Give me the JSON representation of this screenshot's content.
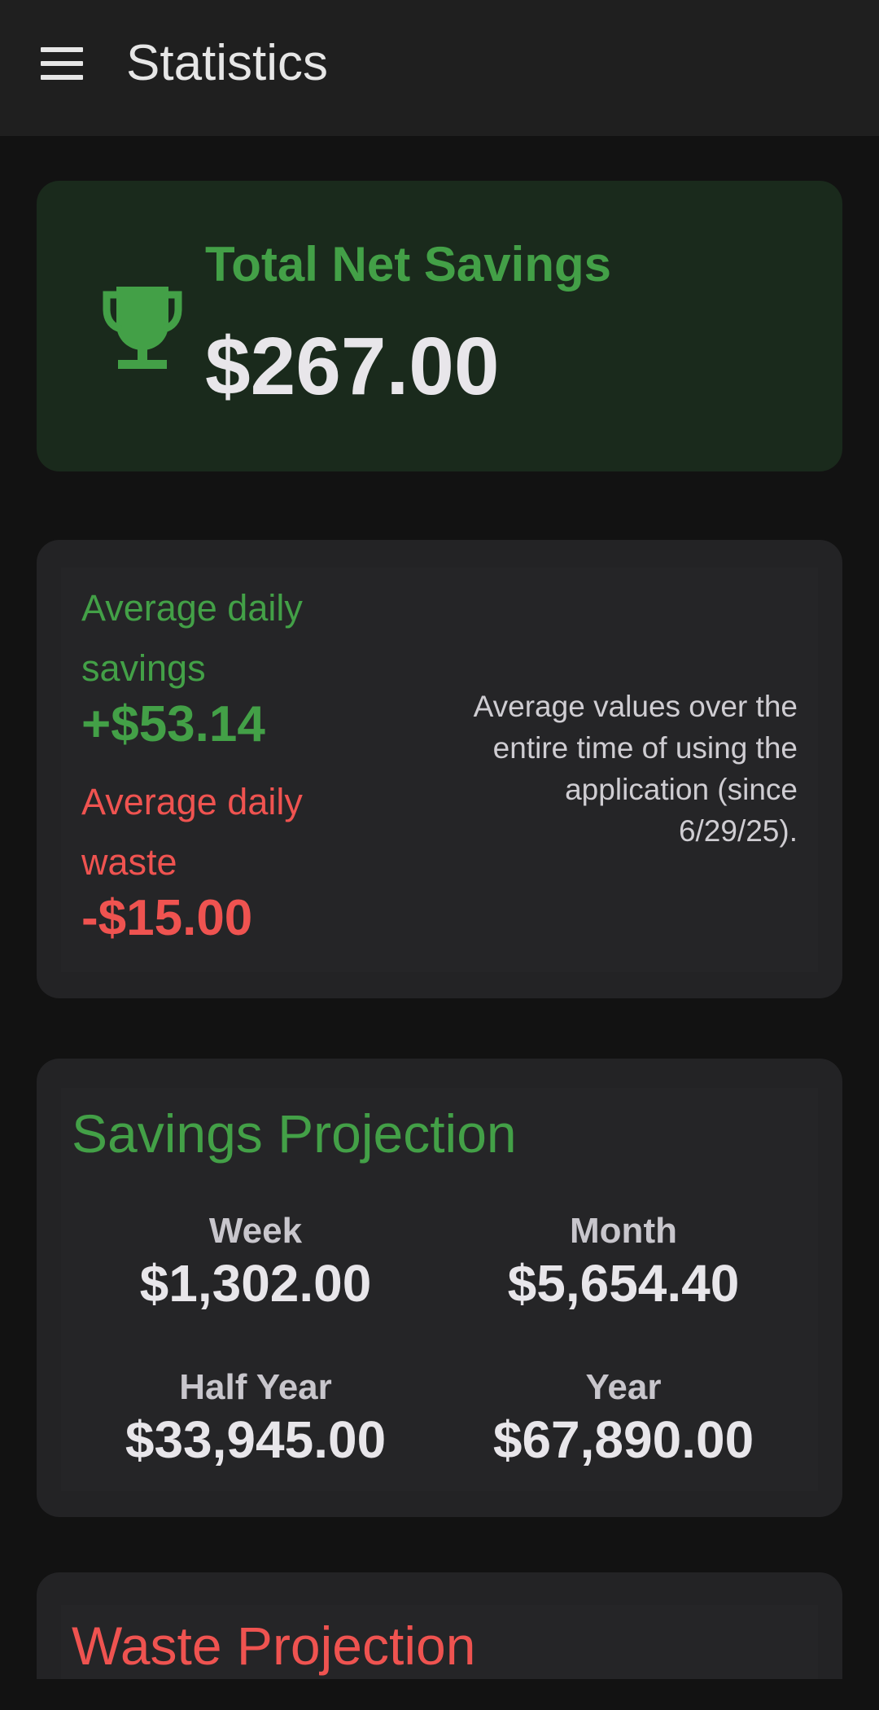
{
  "app_bar": {
    "title": "Statistics",
    "menu_icon": "hamburger-menu-icon"
  },
  "colors": {
    "background": "#121212",
    "savings_green": "#43a047",
    "waste_red": "#ef5350",
    "card": "#232325",
    "text_primary": "#e8e6ea"
  },
  "total_savings": {
    "icon": "trophy-icon",
    "label": "Total Net Savings",
    "value": "$267.00"
  },
  "averages": {
    "savings_label": "Average daily savings",
    "savings_value": "+$53.14",
    "waste_label": "Average daily waste",
    "waste_value": "-$15.00",
    "note": "Average values over the entire time of using the application (since 6/29/25)."
  },
  "savings_projection": {
    "title": "Savings Projection",
    "items": [
      {
        "label": "Week",
        "value": "$1,302.00"
      },
      {
        "label": "Month",
        "value": "$5,654.40"
      },
      {
        "label": "Half Year",
        "value": "$33,945.00"
      },
      {
        "label": "Year",
        "value": "$67,890.00"
      }
    ]
  },
  "waste_projection": {
    "title": "Waste Projection"
  }
}
